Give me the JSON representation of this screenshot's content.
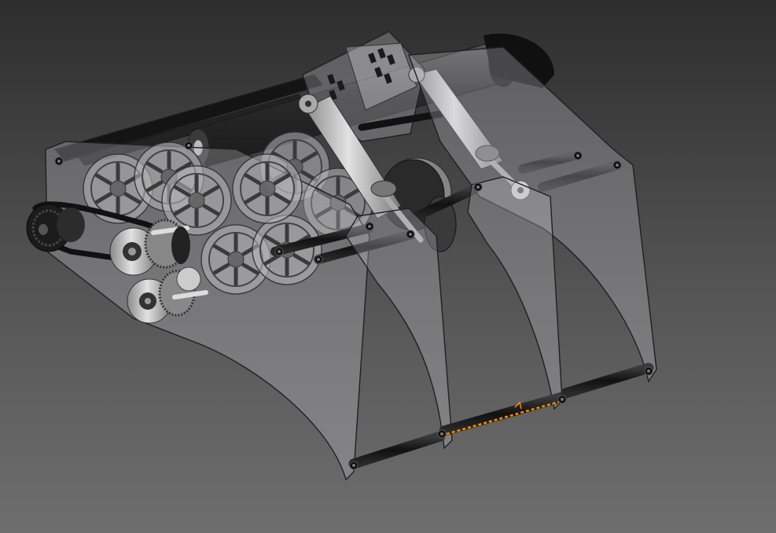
{
  "viewport": {
    "background_top": "#2d2d2d",
    "background_bottom": "#6e6e6e"
  },
  "model": {
    "plate_color": "#c8c8cd",
    "rod_color": "#151515",
    "metal_color": "#b9b9b9",
    "selection_color": "#ff8c00",
    "components": {
      "frame": "side-plate",
      "roller": "spoked-roller",
      "drive": "pulley-belt",
      "actuator": "linear-actuator",
      "shaft": "cross-shaft"
    }
  }
}
